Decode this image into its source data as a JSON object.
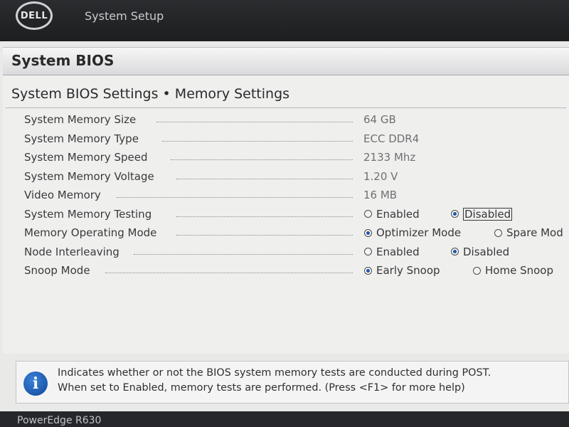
{
  "header": {
    "logo_text": "DELL",
    "app_title": "System Setup"
  },
  "panel": {
    "title": "System BIOS",
    "subtitle": "System BIOS Settings • Memory Settings"
  },
  "settings": {
    "memory_size": {
      "label": "System Memory Size",
      "value": "64 GB"
    },
    "memory_type": {
      "label": "System Memory Type",
      "value": "ECC DDR4"
    },
    "memory_speed": {
      "label": "System Memory Speed",
      "value": "2133 Mhz"
    },
    "memory_voltage": {
      "label": "System Memory Voltage",
      "value": "1.20 V"
    },
    "video_memory": {
      "label": "Video Memory",
      "value": "16 MB"
    },
    "memory_testing": {
      "label": "System Memory Testing",
      "options": [
        "Enabled",
        "Disabled"
      ],
      "selected": "Disabled"
    },
    "operating_mode": {
      "label": "Memory Operating Mode",
      "options": [
        "Optimizer Mode",
        "Spare Mod"
      ],
      "selected": "Optimizer Mode"
    },
    "node_interleaving": {
      "label": "Node Interleaving",
      "options": [
        "Enabled",
        "Disabled"
      ],
      "selected": "Disabled"
    },
    "snoop_mode": {
      "label": "Snoop Mode",
      "options": [
        "Early Snoop",
        "Home Snoop"
      ],
      "selected": "Early Snoop"
    }
  },
  "help": {
    "icon": "info-icon",
    "glyph": "i",
    "line1": "Indicates whether or not the BIOS system memory tests are conducted during POST.",
    "line2": "When set to Enabled, memory tests are performed. (Press <F1> for more help)"
  },
  "footer": {
    "model": "PowerEdge R630"
  },
  "colors": {
    "accent": "#1a56b0",
    "topbar": "#1f2023",
    "panel": "#efefee"
  }
}
